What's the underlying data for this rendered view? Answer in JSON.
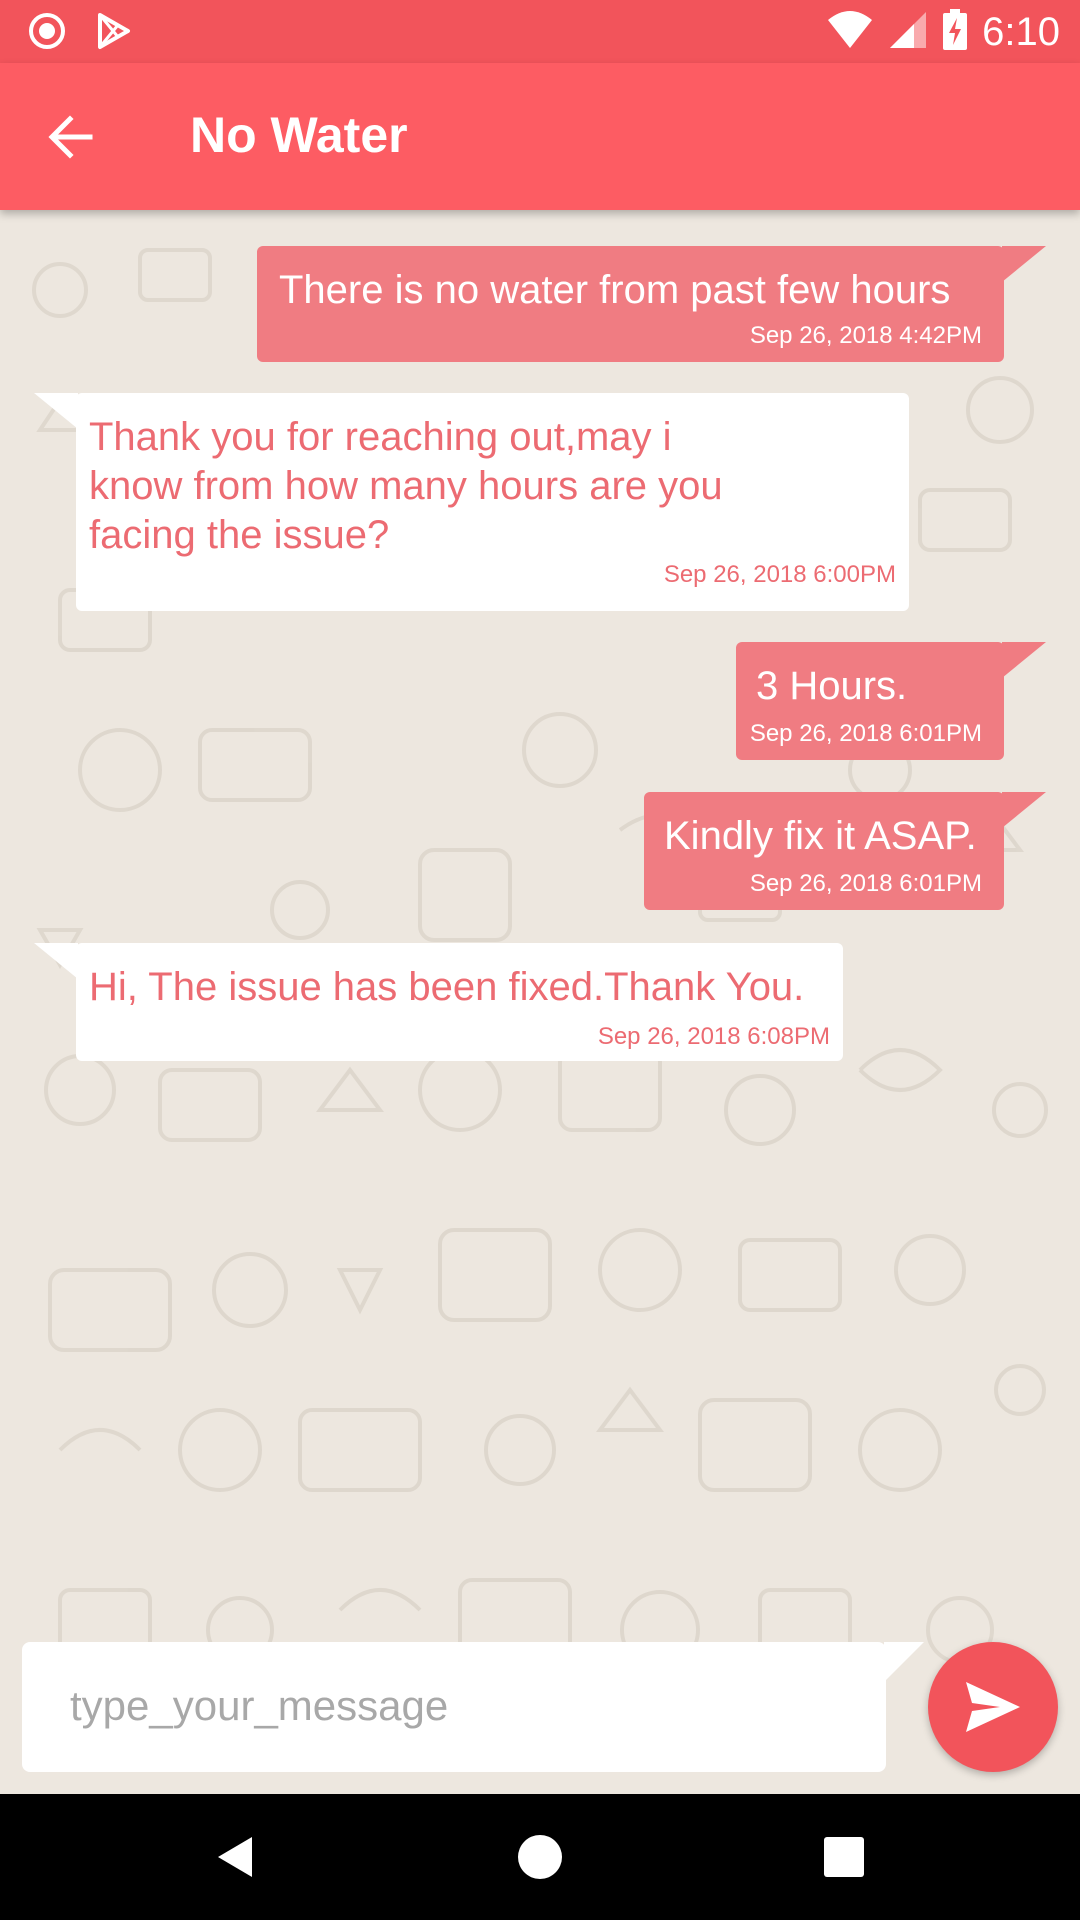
{
  "status_bar": {
    "time": "6:10",
    "icons": [
      "record-icon",
      "play-store-icon",
      "wifi-icon",
      "signal-icon",
      "battery-charging-icon"
    ]
  },
  "toolbar": {
    "title": "No Water",
    "back_icon": "arrow-back-icon"
  },
  "messages": [
    {
      "direction": "out",
      "text": "There is no water from past few hours",
      "time": "Sep 26, 2018 4:42PM"
    },
    {
      "direction": "in",
      "text": "Thank you for reaching out,may i\nknow from how many hours are you\nfacing the issue?",
      "time": "Sep 26, 2018 6:00PM"
    },
    {
      "direction": "out",
      "text": "3 Hours.",
      "time": "Sep 26, 2018 6:01PM"
    },
    {
      "direction": "out",
      "text": "Kindly fix it ASAP.",
      "time": "Sep 26, 2018 6:01PM"
    },
    {
      "direction": "in",
      "text": "Hi, The issue has been fixed.Thank You.",
      "time": "Sep 26, 2018 6:08PM"
    }
  ],
  "composer": {
    "placeholder": "type_your_message",
    "value": "",
    "send_icon": "send-icon"
  },
  "nav_bar": {
    "icons": [
      "back-triangle-icon",
      "home-circle-icon",
      "recents-square-icon"
    ]
  },
  "colors": {
    "status_bar": "#f2545b",
    "toolbar": "#fd5c63",
    "outgoing_bubble": "#f07c82",
    "incoming_bubble": "#ffffff",
    "incoming_text": "#ec6b72",
    "chat_background": "#ede7df"
  }
}
